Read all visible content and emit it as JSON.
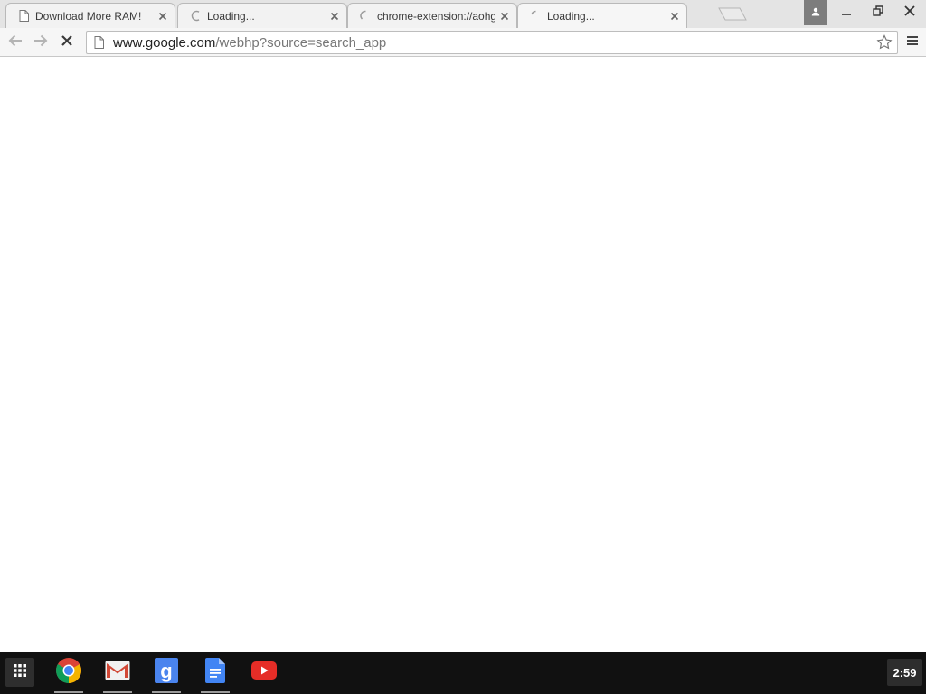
{
  "browser": {
    "tabs": [
      {
        "title": "Download More RAM!",
        "favicon": "page-icon",
        "state": "loaded"
      },
      {
        "title": "Loading...",
        "favicon": "spinner-icon",
        "state": "loading"
      },
      {
        "title": "chrome-extension://aohg",
        "favicon": "spinner-icon",
        "state": "loading"
      },
      {
        "title": "Loading...",
        "favicon": "spinner-icon",
        "state": "loading",
        "active": true
      }
    ],
    "omnibox": {
      "host": "www.google.com",
      "path": "/webhp?source=search_app"
    },
    "toolbar_icons": [
      "back-arrow-icon",
      "forward-arrow-icon",
      "stop-icon",
      "star-icon",
      "menu-icon"
    ],
    "window_controls": [
      "profile-icon",
      "minimize-icon",
      "restore-icon",
      "close-icon"
    ]
  },
  "shelf": {
    "apps": [
      {
        "name": "chrome",
        "icon": "chrome-icon"
      },
      {
        "name": "gmail",
        "icon": "gmail-icon"
      },
      {
        "name": "google-search",
        "icon": "google-search-icon"
      },
      {
        "name": "docs",
        "icon": "docs-icon"
      },
      {
        "name": "youtube",
        "icon": "youtube-icon"
      }
    ],
    "clock": "2:59"
  },
  "colors": {
    "tabstrip": "#e4e4e4",
    "toolbar": "#f6f6f6",
    "shelf": "#111111",
    "spinner": "#9a9a9a"
  }
}
